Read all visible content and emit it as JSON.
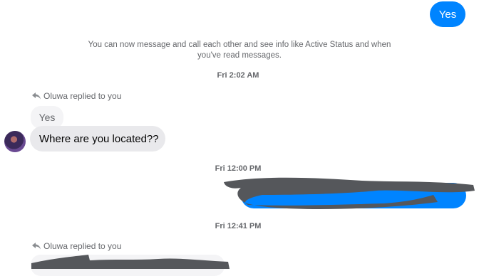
{
  "conversation": {
    "sent_top": {
      "text": "Yes"
    },
    "notice": {
      "text": "You can now message and call each other and see info like Active Status and when you've read messages."
    },
    "timestamps": {
      "t1": "Fri 2:02 AM",
      "t2": "Fri 12:00 PM",
      "t3": "Fri 12:41 PM"
    },
    "reply_1": {
      "replied_label": "Oluwa replied to you",
      "quoted_text": "Yes",
      "message_text": "Where are you located??"
    },
    "reply_2": {
      "replied_label": "Oluwa replied to you"
    }
  },
  "icons": {
    "reply": "reply-arrow-icon",
    "avatar": "avatar"
  },
  "colors": {
    "sent_bubble": "#0084ff",
    "received_bubble": "#e9e9ec",
    "redaction": "#55575b"
  }
}
